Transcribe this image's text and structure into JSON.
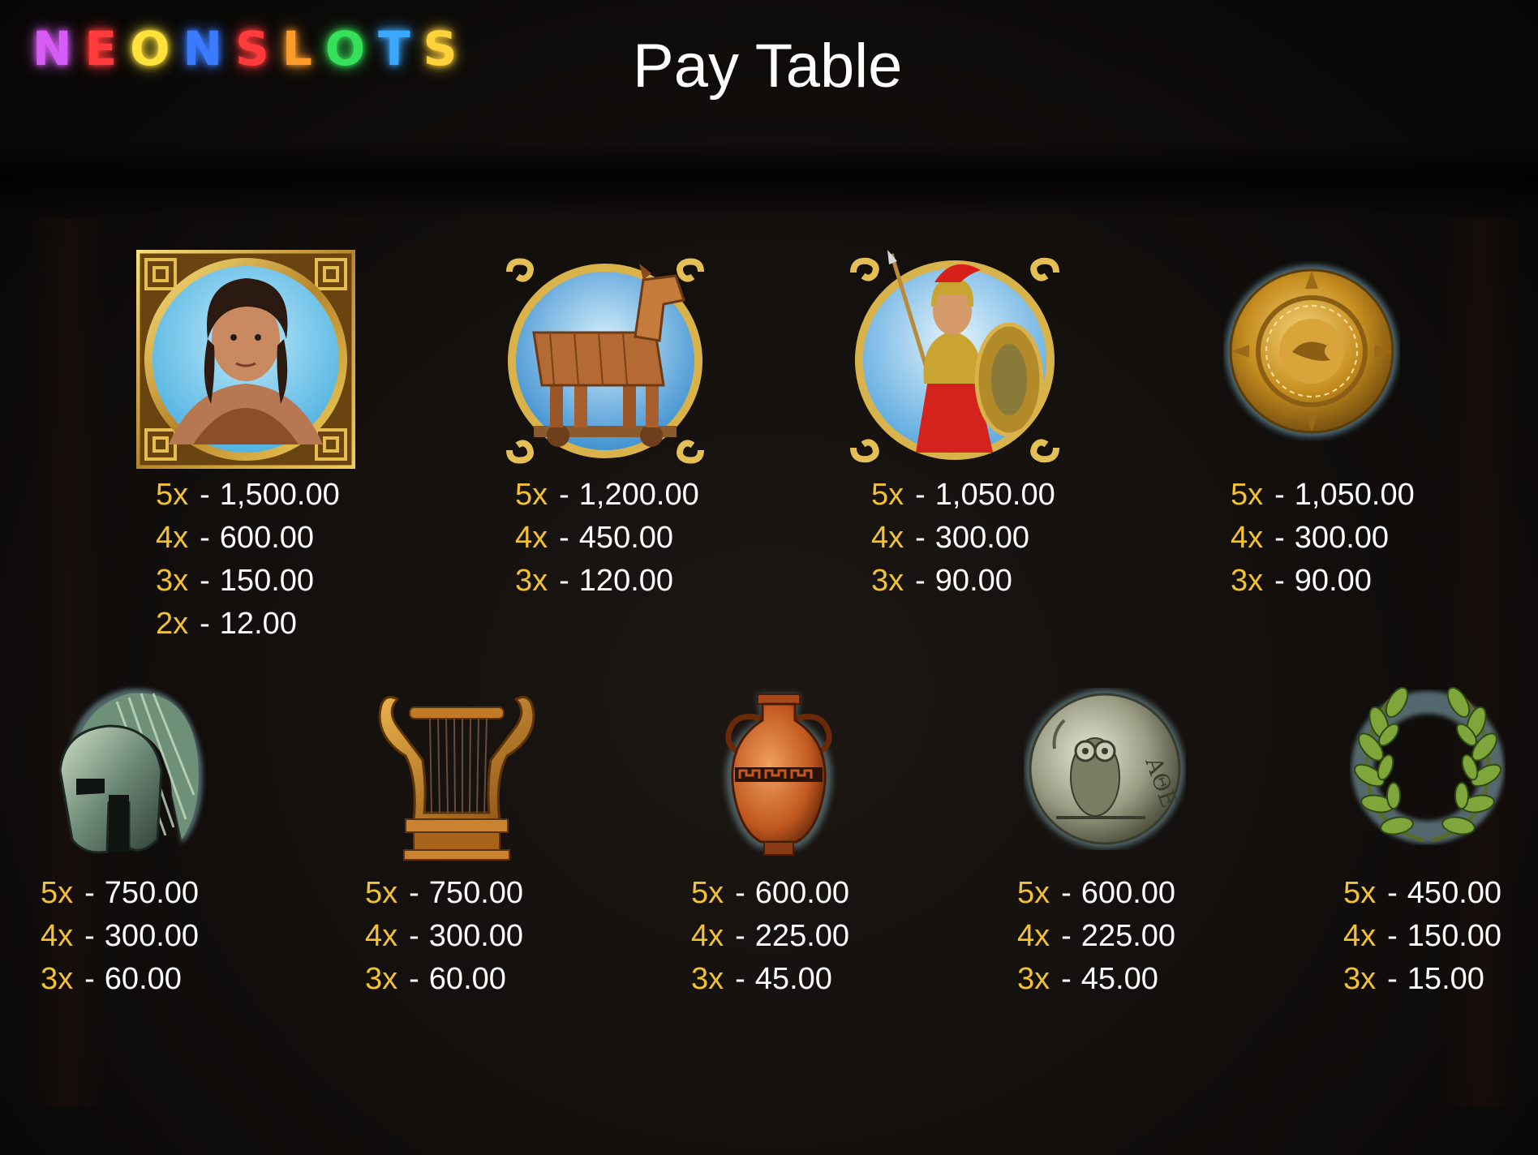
{
  "logo": {
    "letters": [
      "N",
      "E",
      "O",
      "N",
      "S",
      "L",
      "O",
      "T",
      "S"
    ],
    "colors": [
      "#d65cf5",
      "#ff3b3b",
      "#ffe23b",
      "#3b7bff",
      "#ff3b3b",
      "#ff9b2a",
      "#37e05a",
      "#3ba8ff",
      "#ffd23b"
    ]
  },
  "title": "Pay Table",
  "dash": "-",
  "symbols_top": [
    {
      "icon": "hero-portrait-icon",
      "pays": [
        {
          "m": "5x",
          "v": "1,500.00"
        },
        {
          "m": "4x",
          "v": "600.00"
        },
        {
          "m": "3x",
          "v": "150.00"
        },
        {
          "m": "2x",
          "v": "12.00"
        }
      ]
    },
    {
      "icon": "trojan-horse-icon",
      "pays": [
        {
          "m": "5x",
          "v": "1,200.00"
        },
        {
          "m": "4x",
          "v": "450.00"
        },
        {
          "m": "3x",
          "v": "120.00"
        }
      ]
    },
    {
      "icon": "spartan-warrior-icon",
      "pays": [
        {
          "m": "5x",
          "v": "1,050.00"
        },
        {
          "m": "4x",
          "v": "300.00"
        },
        {
          "m": "3x",
          "v": "90.00"
        }
      ]
    },
    {
      "icon": "golden-shield-icon",
      "pays": [
        {
          "m": "5x",
          "v": "1,050.00"
        },
        {
          "m": "4x",
          "v": "300.00"
        },
        {
          "m": "3x",
          "v": "90.00"
        }
      ]
    }
  ],
  "symbols_bottom": [
    {
      "icon": "helmet-icon",
      "pays": [
        {
          "m": "5x",
          "v": "750.00"
        },
        {
          "m": "4x",
          "v": "300.00"
        },
        {
          "m": "3x",
          "v": "60.00"
        }
      ]
    },
    {
      "icon": "lyre-icon",
      "pays": [
        {
          "m": "5x",
          "v": "750.00"
        },
        {
          "m": "4x",
          "v": "300.00"
        },
        {
          "m": "3x",
          "v": "60.00"
        }
      ]
    },
    {
      "icon": "amphora-icon",
      "pays": [
        {
          "m": "5x",
          "v": "600.00"
        },
        {
          "m": "4x",
          "v": "225.00"
        },
        {
          "m": "3x",
          "v": "45.00"
        }
      ]
    },
    {
      "icon": "owl-coin-icon",
      "coin_text": "ΑΘΕ",
      "pays": [
        {
          "m": "5x",
          "v": "600.00"
        },
        {
          "m": "4x",
          "v": "225.00"
        },
        {
          "m": "3x",
          "v": "45.00"
        }
      ]
    },
    {
      "icon": "laurel-wreath-icon",
      "pays": [
        {
          "m": "5x",
          "v": "450.00"
        },
        {
          "m": "4x",
          "v": "150.00"
        },
        {
          "m": "3x",
          "v": "15.00"
        }
      ]
    }
  ]
}
